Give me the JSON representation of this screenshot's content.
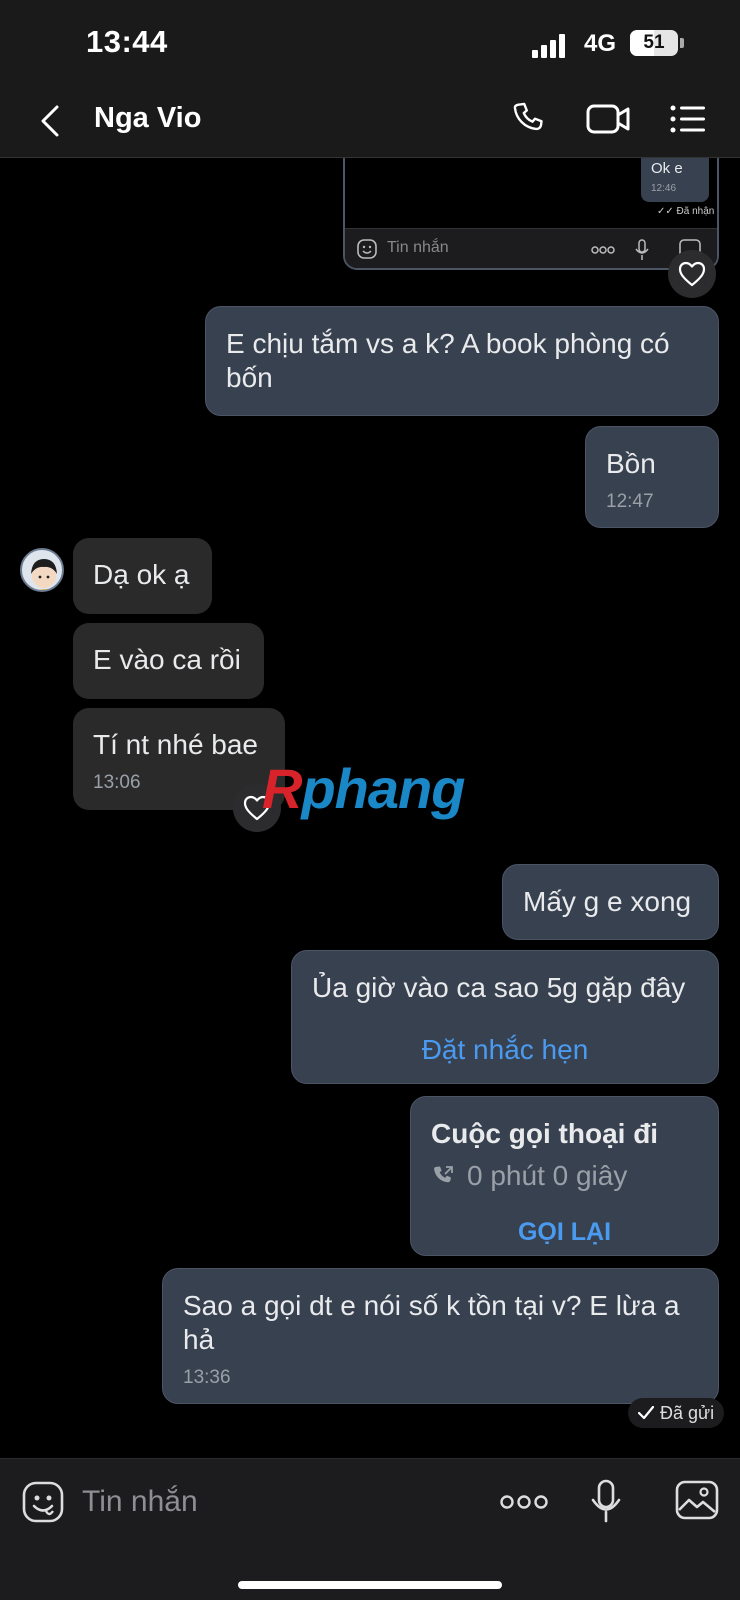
{
  "status_bar": {
    "time": "13:44",
    "network": "4G",
    "battery": "51",
    "battery_level": 0.51
  },
  "header": {
    "contact_name": "Nga Vio"
  },
  "quoted_screenshot": {
    "bubble_text": "Ok e",
    "bubble_time": "12:46",
    "status": "Đã nhận",
    "input_placeholder": "Tin nhắn"
  },
  "messages": [
    {
      "id": "m1",
      "dir": "out",
      "text": "E chịu tắm vs a k? A book phòng có bốn"
    },
    {
      "id": "m2",
      "dir": "out",
      "text": "Bồn",
      "time": "12:47"
    },
    {
      "id": "m3",
      "dir": "in",
      "text": "Dạ ok ạ"
    },
    {
      "id": "m4",
      "dir": "in",
      "text": "E vào ca rồi"
    },
    {
      "id": "m5",
      "dir": "in",
      "text": "Tí nt nhé bae",
      "time": "13:06"
    },
    {
      "id": "m6",
      "dir": "out",
      "text": "Mấy g e xong"
    },
    {
      "id": "m7",
      "dir": "out",
      "text": "Ủa giờ vào ca sao 5g gặp đây",
      "action": "Đặt nhắc hẹn"
    },
    {
      "id": "m8",
      "dir": "out",
      "call_title": "Cuộc gọi thoại đi",
      "call_duration": "0 phút 0 giây",
      "action": "GỌI LẠI"
    },
    {
      "id": "m9",
      "dir": "out",
      "text": "Sao a gọi dt e nói số k tồn tại v? E lừa a hả",
      "time": "13:36"
    }
  ],
  "sent_status": "Đã gửi",
  "watermark": {
    "first": "R",
    "rest": "phang"
  },
  "input_bar": {
    "placeholder": "Tin nhắn"
  },
  "colors": {
    "outgoing_bubble": "#384150",
    "incoming_bubble": "#2a2a2b",
    "link": "#4a9bf0",
    "background": "#000000"
  }
}
